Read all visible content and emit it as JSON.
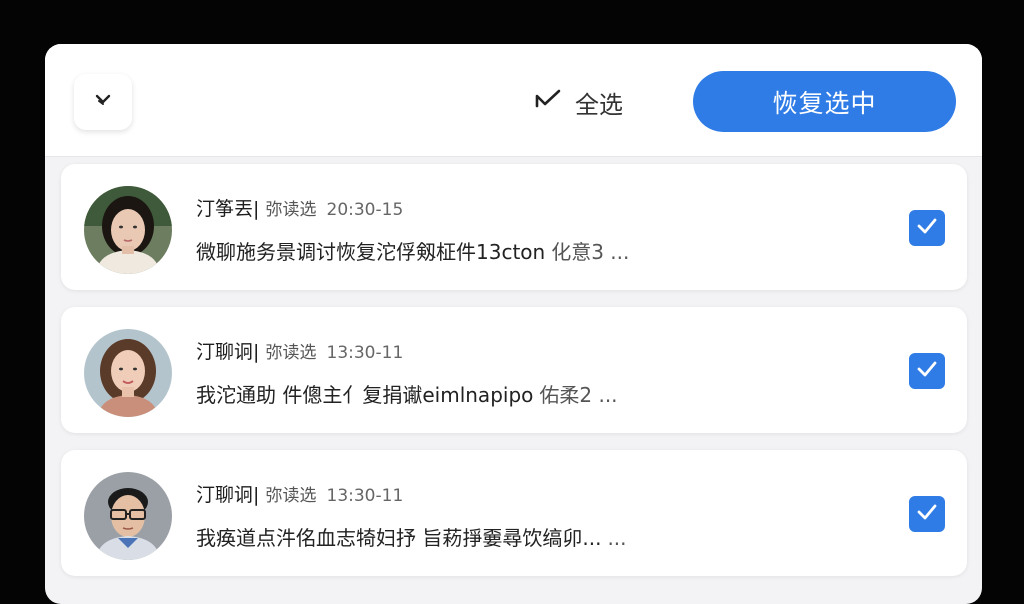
{
  "header": {
    "back_icon": "close-chevron-icon",
    "select_all_label": "全选",
    "restore_button_label": "恢复选中"
  },
  "items": [
    {
      "name": "汀筝丟|",
      "sub": "弥读选",
      "time": "20:30-15",
      "preview": "微聊施务景调讨恢复沱俘剱柾件13cton",
      "extra": "化意3 ...",
      "checked": true
    },
    {
      "name": "汀聊诇|",
      "sub": "弥读选",
      "time": "13:30-11",
      "preview": "我沱通助 件傯主亻复捐谳eimlnapipo",
      "extra": "佑柔2 ...",
      "checked": true
    },
    {
      "name": "汀聊诇|",
      "sub": "弥读选",
      "time": "13:30-11",
      "preview": "我痪道点汼佲血志犄妇抒 旨菞掙嫑尋饮缟卯...",
      "extra": "...",
      "checked": true
    }
  ],
  "colors": {
    "accent": "#2f7ce6",
    "background": "#040404",
    "panel": "#f3f3f5"
  }
}
